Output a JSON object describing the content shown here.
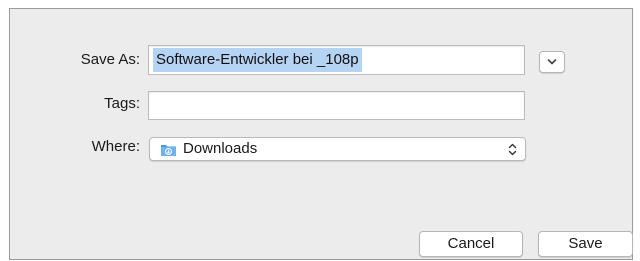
{
  "form": {
    "save_as_label": "Save As:",
    "save_as_value": "Software-Entwickler bei _108p",
    "tags_label": "Tags:",
    "tags_value": "",
    "where_label": "Where:",
    "where_value": "Downloads"
  },
  "buttons": {
    "cancel": "Cancel",
    "save": "Save"
  },
  "icons": {
    "expand": "chevron-down-icon",
    "folder": "downloads-folder-icon",
    "popup_arrows": "updown-arrows-icon"
  },
  "colors": {
    "selection": "#b5d3f3",
    "folder": "#4a9be3",
    "dialog_bg": "#ececec"
  }
}
